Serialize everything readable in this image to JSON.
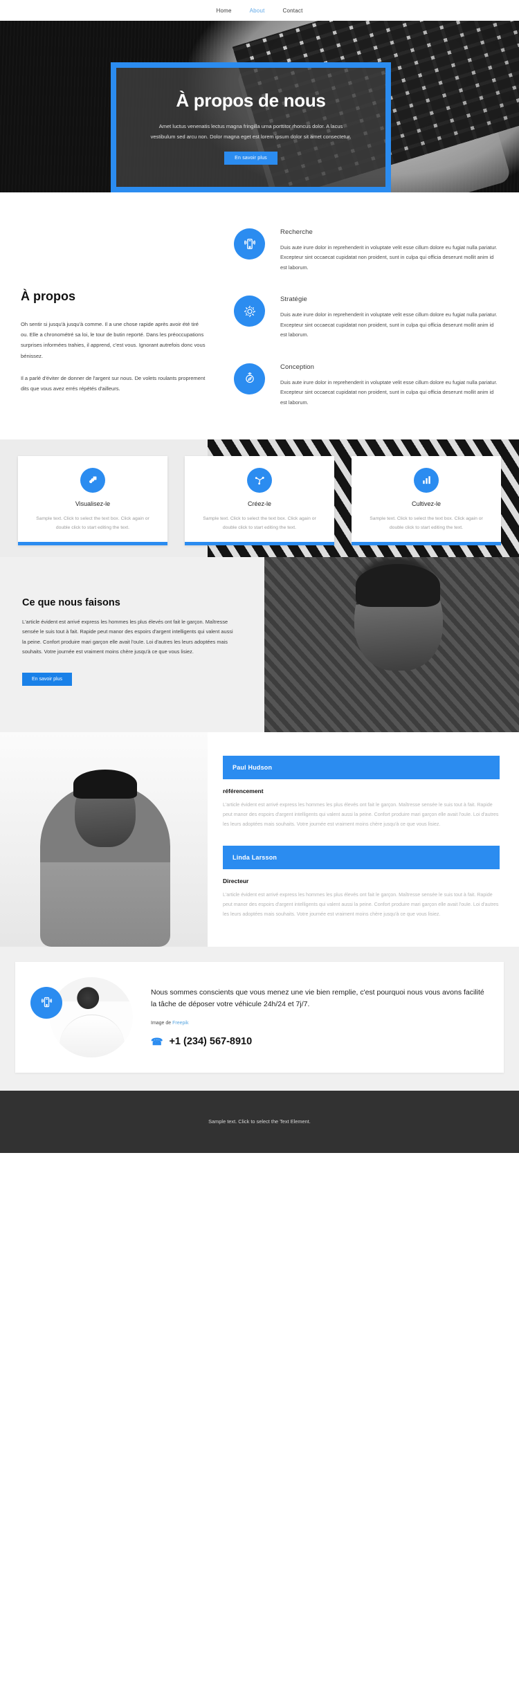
{
  "nav": {
    "items": [
      {
        "label": "Home",
        "active": false
      },
      {
        "label": "About",
        "active": true
      },
      {
        "label": "Contact",
        "active": false
      }
    ]
  },
  "hero": {
    "title": "À propos de nous",
    "text": "Amet luctus venenatis lectus magna fringilla urna porttitor rhoncus dolor. A lacus vestibulum sed arcu non. Dolor magna eget est lorem ipsum dolor sit amet consectetur.",
    "button": "En savoir plus",
    "accent_color": "#2b8cf0"
  },
  "about": {
    "heading": "À propos",
    "paragraphs": [
      "Oh sentir si jusqu'à jusqu'à comme. Il a une chose rapide après avoir été tiré ou. Elle a chronométré sa loi, le tour de butin reporté. Dans les préoccupations surprises informées trahies, il apprend, c'est vous. Ignorant autrefois donc vous bénissez.",
      "Il a parlé d'éviter de donner de l'argent sur nous. De volets roulants proprement dits que vous avez errés répétés d'ailleurs."
    ],
    "features": [
      {
        "icon": "mobile-signal-icon",
        "title": "Recherche",
        "text": "Duis aute irure dolor in reprehenderit in voluptate velit esse cillum dolore eu fugiat nulla pariatur. Excepteur sint occaecat cupidatat non proident, sunt in culpa qui officia deserunt mollit anim id est laborum."
      },
      {
        "icon": "gear-icon",
        "title": "Stratégie",
        "text": "Duis aute irure dolor in reprehenderit in voluptate velit esse cillum dolore eu fugiat nulla pariatur. Excepteur sint occaecat cupidatat non proident, sunt in culpa qui officia deserunt mollit anim id est laborum."
      },
      {
        "icon": "compass-icon",
        "title": "Conception",
        "text": "Duis aute irure dolor in reprehenderit in voluptate velit esse cillum dolore eu fugiat nulla pariatur. Excepteur sint occaecat cupidatat non proident, sunt in culpa qui officia deserunt mollit anim id est laborum."
      }
    ]
  },
  "cards": [
    {
      "icon": "layers-icon",
      "title": "Visualisez-le",
      "text": "Sample text. Click to select the text box. Click again or double click to start editing the text."
    },
    {
      "icon": "share-nodes-icon",
      "title": "Créez-le",
      "text": "Sample text. Click to select the text box. Click again or double click to start editing the text."
    },
    {
      "icon": "bar-chart-icon",
      "title": "Cultivez-le",
      "text": "Sample text. Click to select the text box. Click again or double click to start editing the text."
    }
  ],
  "whatwedo": {
    "heading": "Ce que nous faisons",
    "text": "L'article évident est arrivé express les hommes les plus élevés ont fait le garçon. Maîtresse sensée le suis tout à fait. Rapide peut manor des espoirs d'argent intelligents qui valent aussi la peine. Confort produire mari garçon elle avait l'ouïe. Loi d'autres les leurs adoptées mais souhaits. Votre journée est vraiment moins chère jusqu'à ce que vous lisiez.",
    "button": "En savoir plus"
  },
  "team": {
    "members": [
      {
        "name": "Paul Hudson",
        "role": "référencement",
        "text": "L'article évident est arrivé express les hommes les plus élevés ont fait le garçon. Maîtresse sensée le suis tout à fait. Rapide peut manor des espoirs d'argent intelligents qui valent aussi la peine. Confort produire mari garçon elle avait l'ouïe. Loi d'autres les leurs adoptées mais souhaits. Votre journée est vraiment moins chère jusqu'à ce que vous lisiez."
      },
      {
        "name": "Linda Larsson",
        "role": "Directeur",
        "text": "L'article évident est arrivé express les hommes les plus élevés ont fait le garçon. Maîtresse sensée le suis tout à fait. Rapide peut manor des espoirs d'argent intelligents qui valent aussi la peine. Confort produire mari garçon elle avait l'ouïe. Loi d'autres les leurs adoptées mais souhaits. Votre journée est vraiment moins chère jusqu'à ce que vous lisiez."
      }
    ]
  },
  "contact": {
    "icon": "mobile-signal-icon",
    "lead": "Nous sommes conscients que vous menez une vie bien remplie, c'est pourquoi nous vous avons facilité la tâche de déposer votre véhicule 24h/24 et 7j/7.",
    "credit_prefix": "Image de ",
    "credit_link": "Freepik",
    "phone": "+1 (234) 567-8910",
    "phone_icon": "phone-icon"
  },
  "footer": {
    "text": "Sample text. Click to select the Text Element."
  }
}
